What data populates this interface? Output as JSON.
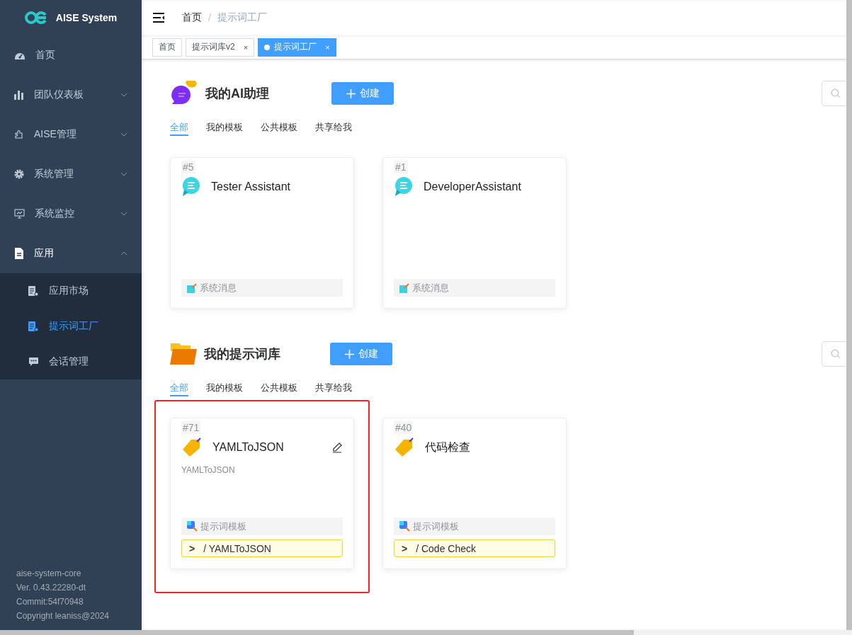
{
  "sidebar": {
    "logo": {
      "title": "AISE System"
    },
    "items": [
      {
        "label": "首页",
        "kind": "link",
        "selected": false
      },
      {
        "label": "团队仪表板",
        "kind": "group",
        "expanded": false
      },
      {
        "label": "AISE管理",
        "kind": "group",
        "expanded": false
      },
      {
        "label": "系统管理",
        "kind": "group",
        "expanded": false
      },
      {
        "label": "系统监控",
        "kind": "group",
        "expanded": false
      },
      {
        "label": "应用",
        "kind": "group",
        "expanded": true,
        "children": [
          {
            "label": "应用市场",
            "selected": false
          },
          {
            "label": "提示词工厂",
            "selected": true
          },
          {
            "label": "会话管理",
            "selected": false
          }
        ]
      }
    ],
    "footer": [
      "aise-system-core",
      "Ver. 0.43.22280-dt",
      "Commit:54f70948",
      "Copyright leaniss@2024"
    ]
  },
  "header": {
    "breadcrumb": [
      "首页",
      "提示词工厂"
    ],
    "separator": "/"
  },
  "tags": [
    {
      "label": "首页",
      "selected": false
    },
    {
      "label": "提示词库v2",
      "selected": false,
      "close": "×"
    },
    {
      "label": "提示词工厂",
      "selected": true,
      "close": "×"
    }
  ],
  "sections": [
    {
      "kind": "assistant",
      "title": "我的AI助理",
      "create_button": "创建",
      "tabs": [
        {
          "label": "全部",
          "selected": true
        },
        {
          "label": "我的模板",
          "selected": false
        },
        {
          "label": "公共模板",
          "selected": false
        },
        {
          "label": "共享给我",
          "selected": false
        }
      ],
      "cards": [
        {
          "id": "#5",
          "title": "Tester Assistant",
          "footer": "系统消息",
          "editable": false,
          "highlighted": false
        },
        {
          "id": "#1",
          "title": "DeveloperAssistant",
          "footer": "系统消息",
          "editable": false,
          "highlighted": false
        }
      ]
    },
    {
      "kind": "prompt",
      "title": "我的提示词库",
      "create_button": "创建",
      "tabs": [
        {
          "label": "全部",
          "selected": true
        },
        {
          "label": "我的模板",
          "selected": false
        },
        {
          "label": "公共模板",
          "selected": false
        },
        {
          "label": "共享给我",
          "selected": false
        }
      ],
      "cards": [
        {
          "id": "#71",
          "title": "YAMLToJSON",
          "description": "YAMLToJSON",
          "footer": "提示词模板",
          "prompt": ">",
          "command": "/ YAMLToJSON",
          "editable": true,
          "highlighted": true
        },
        {
          "id": "#40",
          "title": "代码检查",
          "footer": "提示词模板",
          "prompt": ">",
          "command": "/ Code Check",
          "editable": false,
          "highlighted": false
        }
      ]
    }
  ]
}
